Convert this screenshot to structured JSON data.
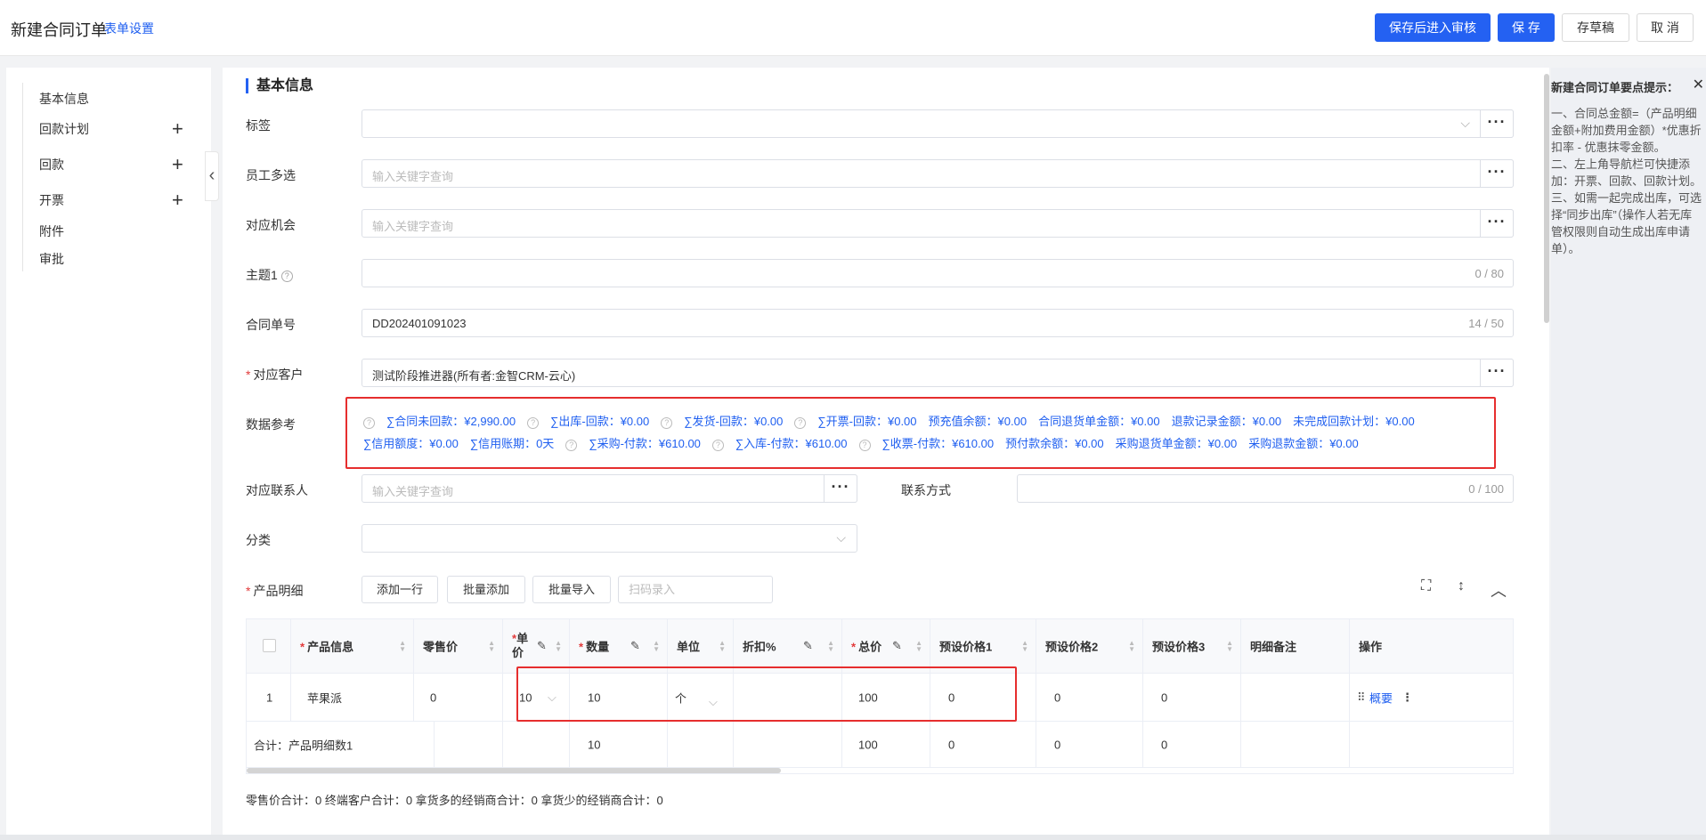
{
  "header": {
    "title": "新建合同订单",
    "form_settings": "表单设置",
    "buttons": {
      "save_and_review": "保存后进入审核",
      "save": "保 存",
      "save_draft": "存草稿",
      "cancel": "取 消"
    }
  },
  "sidebar": {
    "items": [
      {
        "label": "基本信息",
        "has_add": false
      },
      {
        "label": "回款计划",
        "has_add": true
      },
      {
        "label": "回款",
        "has_add": true
      },
      {
        "label": "开票",
        "has_add": true
      },
      {
        "label": "附件",
        "has_add": false
      },
      {
        "label": "审批",
        "has_add": false
      }
    ]
  },
  "section": {
    "title": "基本信息"
  },
  "form": {
    "tag": {
      "label": "标签"
    },
    "employees": {
      "label": "员工多选",
      "placeholder": "输入关键字查询"
    },
    "opportunity": {
      "label": "对应机会",
      "placeholder": "输入关键字查询"
    },
    "subject": {
      "label": "主题1",
      "counter": "0 / 80"
    },
    "contract_no": {
      "label": "合同单号",
      "value": "DD202401091023",
      "counter": "14 / 50"
    },
    "customer": {
      "label": "对应客户",
      "value": "测试阶段推进器(所有者:金智CRM-云心)"
    },
    "data_ref": {
      "label": "数据参考",
      "row1": [
        {
          "text": "∑合同未回款：¥2,990.00",
          "help": true
        },
        {
          "text": "∑出库-回款：¥0.00",
          "help": true
        },
        {
          "text": "∑发货-回款：¥0.00",
          "help": true
        },
        {
          "text": "∑开票-回款：¥0.00",
          "help": true
        },
        {
          "text": "预充值余额：¥0.00",
          "help": false
        },
        {
          "text": "合同退货单金额：¥0.00",
          "help": false
        },
        {
          "text": "退款记录金额：¥0.00",
          "help": false
        },
        {
          "text": "未完成回款计划：¥0.00",
          "help": false
        }
      ],
      "row2": [
        {
          "text": "∑信用额度：¥0.00",
          "help": false
        },
        {
          "text": "∑信用账期：0天",
          "help": false
        },
        {
          "text": "∑采购-付款：¥610.00",
          "help": true
        },
        {
          "text": "∑入库-付款：¥610.00",
          "help": true
        },
        {
          "text": "∑收票-付款：¥610.00",
          "help": true
        },
        {
          "text": "预付款余额：¥0.00",
          "help": false
        },
        {
          "text": "采购退货单金额：¥0.00",
          "help": false
        },
        {
          "text": "采购退款金额：¥0.00",
          "help": false
        }
      ]
    },
    "contact": {
      "label": "对应联系人",
      "placeholder": "输入关键字查询"
    },
    "contact_method": {
      "label": "联系方式",
      "counter": "0 / 100"
    },
    "category": {
      "label": "分类"
    },
    "products": {
      "label": "产品明细"
    }
  },
  "product_toolbar": {
    "add_row": "添加一行",
    "batch_add": "批量添加",
    "batch_import": "批量导入",
    "scan_placeholder": "扫码录入"
  },
  "table": {
    "headers": [
      "产品信息",
      "零售价",
      "单价",
      "数量",
      "单位",
      "折扣%",
      "总价",
      "预设价格1",
      "预设价格2",
      "预设价格3",
      "明细备注",
      "操作"
    ],
    "row": {
      "index": "1",
      "product": "苹果派",
      "retail_price": "0",
      "unit_price": "10",
      "quantity": "10",
      "unit": "个",
      "discount": "",
      "total": "100",
      "preset1": "0",
      "preset2": "0",
      "preset3": "0",
      "note": "",
      "action_link": "概要"
    },
    "total_row": {
      "label": "合计：产品明细数1",
      "quantity": "10",
      "total": "100",
      "preset1": "0",
      "preset2": "0",
      "preset3": "0"
    }
  },
  "totals_line": "零售价合计：0  终端客户合计：0  拿货多的经销商合计：0  拿货少的经销商合计：0",
  "tips": {
    "title": "新建合同订单要点提示：",
    "items": [
      "一、合同总金额=（产品明细金额+附加费用金额）*优惠折扣率 - 优惠抹零金额。",
      "二、左上角导航栏可快捷添加：开票、回款、回款计划。",
      "三、如需一起完成出库，可选择“同步出库”（操作人若无库管权限则自动生成出库申请单）。"
    ]
  },
  "colors": {
    "primary": "#2461f2",
    "link": "#1f5ff0",
    "highlight_border": "#e62e2e",
    "required": "#e23b3b"
  }
}
